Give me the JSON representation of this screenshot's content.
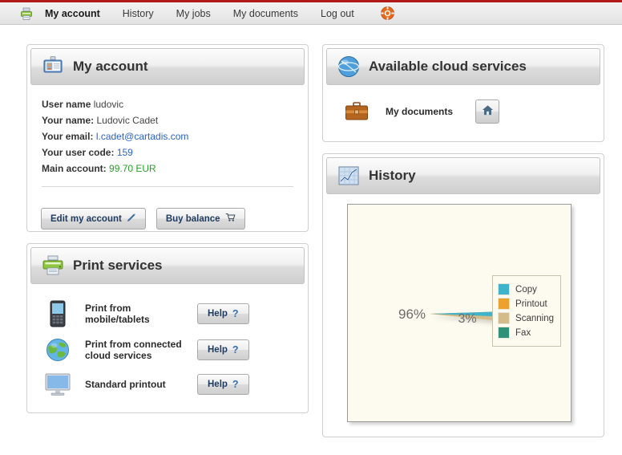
{
  "nav": {
    "brand_icon": "printer-icon",
    "help_icon": "lifering-help-icon",
    "items": [
      {
        "label": "My account",
        "active": true
      },
      {
        "label": "History",
        "active": false
      },
      {
        "label": "My jobs",
        "active": false
      },
      {
        "label": "My documents",
        "active": false
      },
      {
        "label": "Log out",
        "active": false
      }
    ]
  },
  "account_panel": {
    "title": "My account",
    "icon": "id-badge-icon",
    "lines": [
      {
        "label": "User name",
        "value": "ludovic",
        "style": "plain"
      },
      {
        "label": "Your name:",
        "value": "Ludovic Cadet",
        "style": "plain"
      },
      {
        "label": "Your email:",
        "value": "l.cadet@cartadis.com",
        "style": "link"
      },
      {
        "label": "Your user code:",
        "value": "159",
        "style": "link"
      },
      {
        "label": "Main account:",
        "value": "99.70 EUR",
        "style": "money"
      }
    ],
    "buttons": [
      {
        "label": "Edit my account",
        "icon": "pencil-icon"
      },
      {
        "label": "Buy balance",
        "icon": "cart-icon"
      }
    ]
  },
  "print_services_panel": {
    "title": "Print services",
    "icon": "printer-icon",
    "rows": [
      {
        "label": "Print from mobile/tablets",
        "icon": "smartphone-icon",
        "action_label": "Help",
        "action_glyph": "?"
      },
      {
        "label": "Print from connected cloud services",
        "icon": "globe-icon",
        "action_label": "Help",
        "action_glyph": "?"
      },
      {
        "label": "Standard printout",
        "icon": "monitor-icon",
        "action_label": "Help",
        "action_glyph": "?"
      }
    ]
  },
  "cloud_panel": {
    "title": "Available cloud services",
    "icon": "globe-network-icon",
    "rows": [
      {
        "label": "My documents",
        "icon": "briefcase-icon",
        "action_icon": "home-icon"
      }
    ]
  },
  "history_panel": {
    "title": "History",
    "icon": "chart-line-icon"
  },
  "colors": {
    "accent_red": "#b01a1a",
    "copy": "#3fb3cc",
    "printout": "#eda12f",
    "scanning": "#d4bc8a",
    "fax": "#2e9178",
    "chart_bg": "#fdfbef",
    "link": "#2b62c4",
    "money": "#28a028"
  },
  "chart_data": {
    "type": "pie",
    "title": "",
    "labels": [
      "Copy",
      "Printout",
      "Scanning",
      "Fax"
    ],
    "values": [
      3,
      96,
      1,
      0
    ],
    "display_labels": [
      "3%",
      "96%",
      "",
      ""
    ],
    "colors": [
      "#3fb3cc",
      "#eda12f",
      "#d4bc8a",
      "#2e9178"
    ],
    "legend_position": "right",
    "value_suffix": "%",
    "slice_labels_shown": [
      "96%",
      "3%"
    ]
  }
}
